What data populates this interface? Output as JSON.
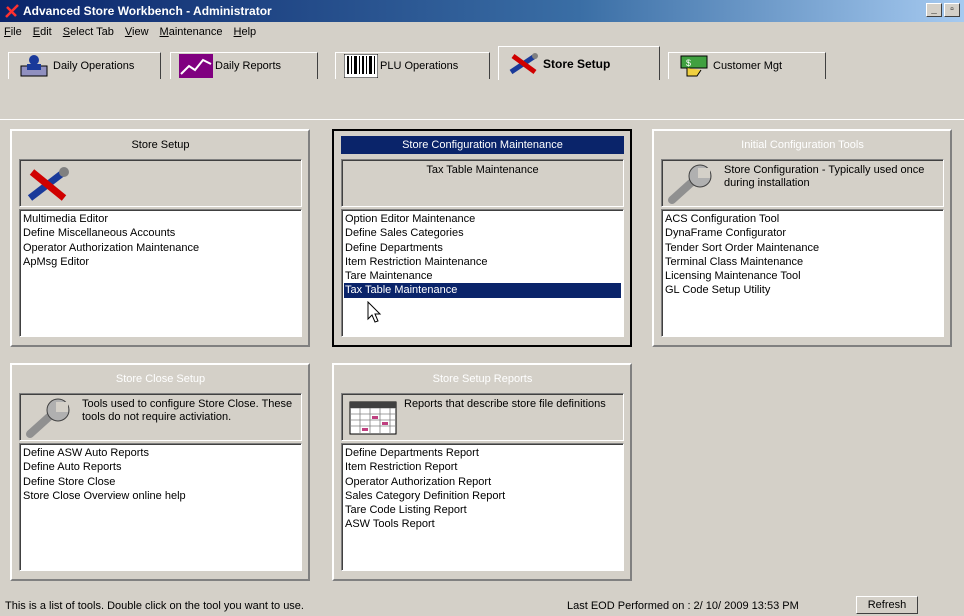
{
  "window": {
    "title": "Advanced Store Workbench - Administrator"
  },
  "menu": [
    "File",
    "Edit",
    "Select Tab",
    "View",
    "Maintenance",
    "Help"
  ],
  "tabs": [
    {
      "label": "Daily Operations",
      "icon": "person-desk-icon",
      "active": false
    },
    {
      "label": "Daily Reports",
      "icon": "chart-line-icon",
      "active": false
    },
    {
      "label": "PLU Operations",
      "icon": "barcode-icon",
      "active": false
    },
    {
      "label": "Store Setup",
      "icon": "tools-icon",
      "active": true
    },
    {
      "label": "Customer Mgt",
      "icon": "money-hand-icon",
      "active": false
    }
  ],
  "panels": {
    "store_setup": {
      "title": "Store Setup",
      "desc": "",
      "items": [
        "Multimedia Editor",
        "Define Miscellaneous Accounts",
        "Operator Authorization Maintenance",
        "ApMsg Editor"
      ]
    },
    "store_config": {
      "title": "Store Configuration Maintenance",
      "desc": "Tax Table Maintenance",
      "items": [
        "Option Editor Maintenance",
        "Define Sales Categories",
        "Define Departments",
        "Item Restriction Maintenance",
        "Tare Maintenance",
        "Tax Table Maintenance"
      ],
      "selected_index": 5
    },
    "initial_config": {
      "title": "Initial Configuration Tools",
      "desc": "Store Configuration - Typically used once during installation",
      "items": [
        "ACS Configuration Tool",
        "DynaFrame Configurator",
        "Tender Sort Order Maintenance",
        "Terminal Class Maintenance",
        "Licensing Maintenance Tool",
        "GL Code Setup Utility"
      ]
    },
    "store_close": {
      "title": "Store Close Setup",
      "desc": "Tools used to configure Store Close. These tools do not require activiation.",
      "items": [
        "Define ASW Auto Reports",
        "Define Auto Reports",
        "Define Store Close",
        "Store Close Overview online help"
      ]
    },
    "setup_reports": {
      "title": "Store Setup Reports",
      "desc": "Reports that describe store file definitions",
      "items": [
        "Define Departments Report",
        "Item Restriction Report",
        "Operator Authorization Report",
        "Sales Category Definition Report",
        "Tare Code Listing Report",
        "ASW Tools Report"
      ]
    }
  },
  "status": {
    "message": "This is a list of tools.  Double click on the tool you want to use.",
    "last_eod": "Last EOD Performed on : 2/ 10/ 2009  13:53 PM",
    "refresh_label": "Refresh"
  },
  "colors": {
    "face": "#d4d0c8",
    "selection": "#0a246a",
    "title_gradient_start": "#0a246a"
  }
}
